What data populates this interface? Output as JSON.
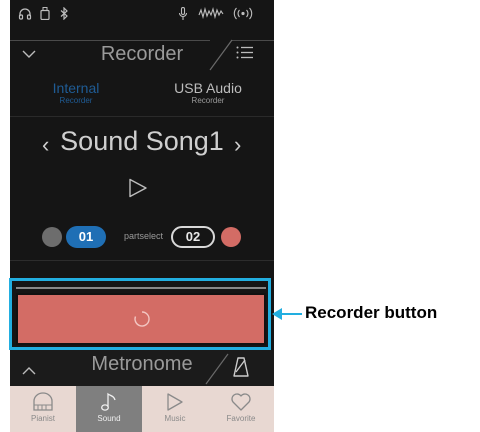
{
  "status_bar": {
    "icons": [
      "headphone-icon",
      "usb-memory-icon",
      "bluetooth-icon",
      "microphone-icon",
      "wave-icon",
      "wireless-icon"
    ]
  },
  "header": {
    "title": "Recorder",
    "left_icon": "chevron-down-icon",
    "right_icon": "menu-list-icon"
  },
  "tabs": [
    {
      "label": "Internal",
      "sublabel": "Recorder",
      "active": true
    },
    {
      "label": "USB Audio",
      "sublabel": "Recorder",
      "active": false
    }
  ],
  "song": {
    "name": "Sound Song1",
    "prev": "‹",
    "next": "›"
  },
  "playback": {
    "icon": "play-icon"
  },
  "part_select": {
    "part1": "01",
    "part2": "02",
    "label": "partselect",
    "colors": {
      "left_dot": "#6d6d6d",
      "part1_bg": "#1f6fb5",
      "right_dot": "#d36c65"
    }
  },
  "recorder_button": {
    "icon": "recording-spinner-icon",
    "color": "#d36c65"
  },
  "metronome": {
    "title": "Metronome",
    "left_icon": "chevron-up-icon",
    "right_icon": "metronome-icon"
  },
  "nav": [
    {
      "label": "Pianist",
      "icon": "piano-icon",
      "selected": false
    },
    {
      "label": "Sound",
      "icon": "music-note-icon",
      "selected": true
    },
    {
      "label": "Music",
      "icon": "play-outline-icon",
      "selected": false
    },
    {
      "label": "Favorite",
      "icon": "heart-icon",
      "selected": false
    }
  ],
  "callout": {
    "text": "Recorder button",
    "color": "#22aee0"
  }
}
